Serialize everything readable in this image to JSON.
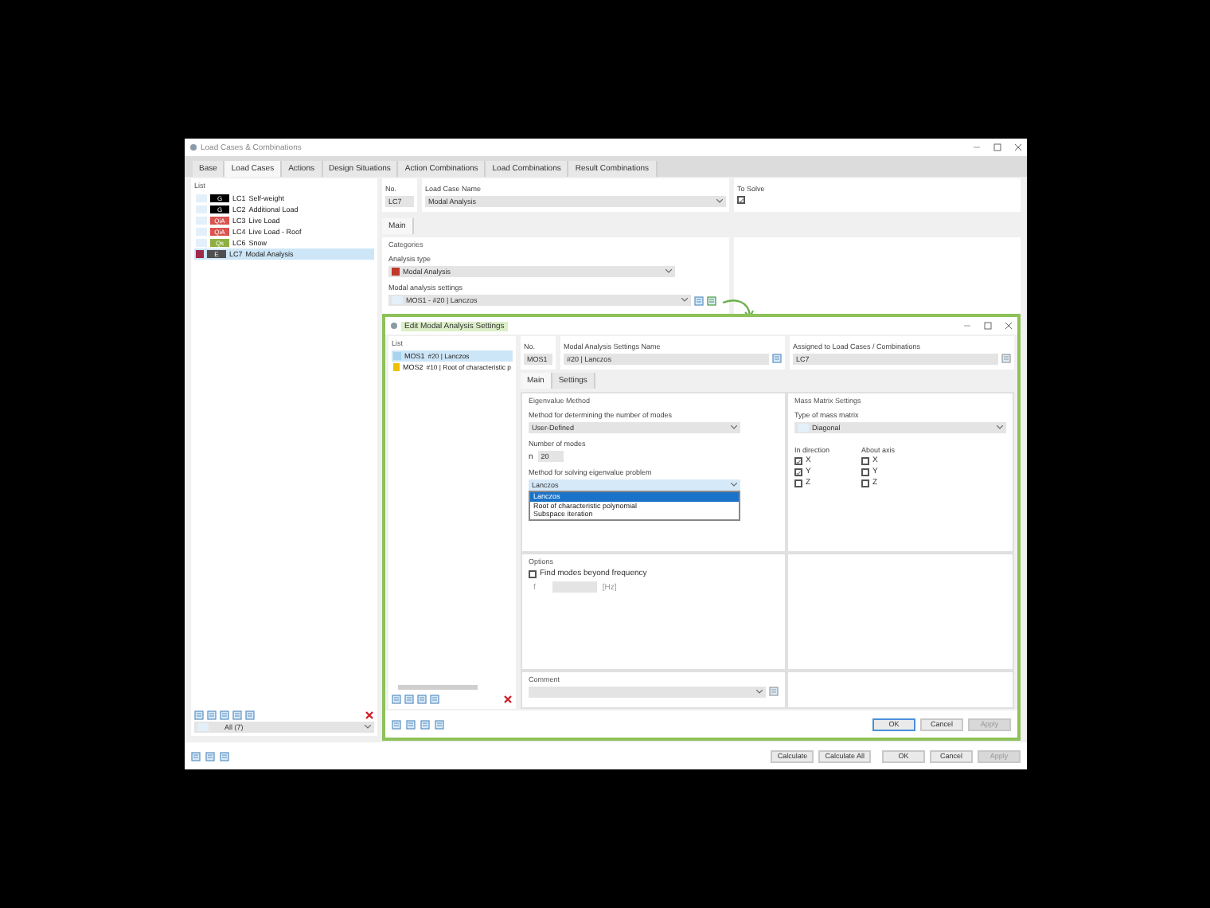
{
  "window": {
    "title": "Load Cases & Combinations"
  },
  "tabs": [
    {
      "label": "Base",
      "selected": false
    },
    {
      "label": "Load Cases",
      "selected": true
    },
    {
      "label": "Actions",
      "selected": false
    },
    {
      "label": "Design Situations",
      "selected": false
    },
    {
      "label": "Action Combinations",
      "selected": false
    },
    {
      "label": "Load Combinations",
      "selected": false
    },
    {
      "label": "Result Combinations",
      "selected": false
    }
  ],
  "list": {
    "heading": "List",
    "items": [
      {
        "code": "G",
        "color": "#000000",
        "id": "LC1",
        "name": "Self-weight",
        "selected": false
      },
      {
        "code": "G",
        "color": "#000000",
        "id": "LC2",
        "name": "Additional Load",
        "selected": false
      },
      {
        "code": "QiA",
        "color": "#d9534f",
        "id": "LC3",
        "name": "Live Load",
        "selected": false
      },
      {
        "code": "QiA",
        "color": "#d9534f",
        "id": "LC4",
        "name": "Live Load - Roof",
        "selected": false
      },
      {
        "code": "Qs",
        "color": "#8db040",
        "id": "LC6",
        "name": "Snow",
        "selected": false
      },
      {
        "code": "E",
        "color": "#505050",
        "id": "LC7",
        "name": "Modal Analysis",
        "selected": true
      }
    ],
    "filter": "All (7)"
  },
  "no": {
    "label": "No.",
    "value": "LC7"
  },
  "name": {
    "label": "Load Case Name",
    "value": "Modal Analysis"
  },
  "to_solve": {
    "label": "To Solve",
    "checked": true
  },
  "subtabs": [
    {
      "label": "Main",
      "selected": true
    }
  ],
  "categories": {
    "heading": "Categories",
    "analysis_label": "Analysis type",
    "analysis_value": "Modal Analysis",
    "settings_label": "Modal analysis settings",
    "settings_value": "MOS1 - #20 | Lanczos"
  },
  "buttons": [
    {
      "label": "Calculate",
      "disabled": false
    },
    {
      "label": "Calculate All",
      "disabled": false
    },
    {
      "label": "OK",
      "disabled": false
    },
    {
      "label": "Cancel",
      "disabled": false
    },
    {
      "label": "Apply",
      "disabled": true
    }
  ],
  "dialog": {
    "title": "Edit Modal Analysis Settings",
    "list": {
      "heading": "List",
      "items": [
        {
          "id": "MOS1",
          "name": "#20 | Lanczos",
          "color": "#a8d4f0",
          "selected": true
        },
        {
          "id": "MOS2",
          "name": "#10 | Root of characteristic p",
          "color": "#f0c000",
          "selected": false
        }
      ]
    },
    "no": {
      "label": "No.",
      "value": "MOS1"
    },
    "name": {
      "label": "Modal Analysis Settings Name",
      "value": "#20 | Lanczos"
    },
    "assigned": {
      "label": "Assigned to Load Cases / Combinations",
      "value": "LC7"
    },
    "tabs": [
      {
        "label": "Main",
        "selected": true
      },
      {
        "label": "Settings",
        "selected": false
      }
    ],
    "eigen": {
      "heading": "Eigenvalue Method",
      "method_label": "Method for determining the number of modes",
      "method_value": "User-Defined",
      "modes_label": "Number of modes",
      "modes_symbol": "n",
      "modes_value": "20",
      "solver_label": "Method for solving eigenvalue problem",
      "solver_value": "Lanczos",
      "solver_options": [
        {
          "label": "Lanczos",
          "selected": true
        },
        {
          "label": "Root of characteristic polynomial",
          "selected": false
        },
        {
          "label": "Subspace iteration",
          "selected": false
        }
      ]
    },
    "mass": {
      "heading": "Mass Matrix Settings",
      "type_label": "Type of mass matrix",
      "type_value": "Diagonal",
      "direction_label": "In direction",
      "axis_label": "About axis",
      "directions": [
        {
          "label": "X",
          "checked": true
        },
        {
          "label": "Y",
          "checked": true
        },
        {
          "label": "Z",
          "checked": false
        }
      ],
      "axes": [
        {
          "label": "X",
          "checked": false
        },
        {
          "label": "Y",
          "checked": false
        },
        {
          "label": "Z",
          "checked": false
        }
      ]
    },
    "options": {
      "heading": "Options",
      "find_label": "Find modes beyond frequency",
      "find_checked": false,
      "f_symbol": "f",
      "f_unit": "[Hz]"
    },
    "comment": {
      "label": "Comment"
    },
    "buttons": [
      {
        "label": "OK",
        "disabled": false
      },
      {
        "label": "Cancel",
        "disabled": false
      },
      {
        "label": "Apply",
        "disabled": true
      }
    ]
  }
}
